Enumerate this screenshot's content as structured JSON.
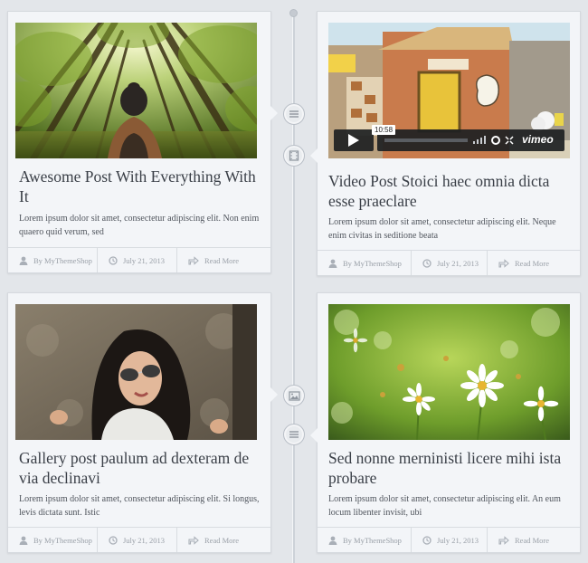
{
  "posts": [
    {
      "title": "Awesome Post With Everything With It",
      "excerpt": "Lorem ipsum dolor sit amet, consectetur adipiscing elit. Non enim quaero quid verum, sed",
      "author": "By MyThemeShop",
      "date": "July 21, 2013",
      "read_more": "Read More",
      "format_icon": "standard-post-icon"
    },
    {
      "title": "Video Post Stoici haec omnia dicta esse praeclare",
      "excerpt": "Lorem ipsum dolor sit amet, consectetur adipiscing elit. Neque enim civitas in seditione beata",
      "author": "By MyThemeShop",
      "date": "July 21, 2013",
      "read_more": "Read More",
      "format_icon": "video-post-icon",
      "video": {
        "time": "10:58",
        "brand": "vimeo"
      }
    },
    {
      "title": "Gallery post paulum ad dexteram de via declinavi",
      "excerpt": "Lorem ipsum dolor sit amet, consectetur adipiscing elit. Si longus, levis dictata sunt. Istic",
      "author": "By MyThemeShop",
      "date": "July 21, 2013",
      "read_more": "Read More",
      "format_icon": "gallery-post-icon"
    },
    {
      "title": "Sed nonne merninisti licere mihi ista probare",
      "excerpt": "Lorem ipsum dolor sit amet, consectetur adipiscing elit. An eum locum libenter invisit, ubi",
      "author": "By MyThemeShop",
      "date": "July 21, 2013",
      "read_more": "Read More",
      "format_icon": "standard-post-icon"
    }
  ],
  "colors": {
    "background": "#e3e6ea",
    "card": "#f3f5f8",
    "title": "#3a3f47",
    "meta": "#9aa0a8",
    "vimeo_bar": "#1d1f22"
  }
}
